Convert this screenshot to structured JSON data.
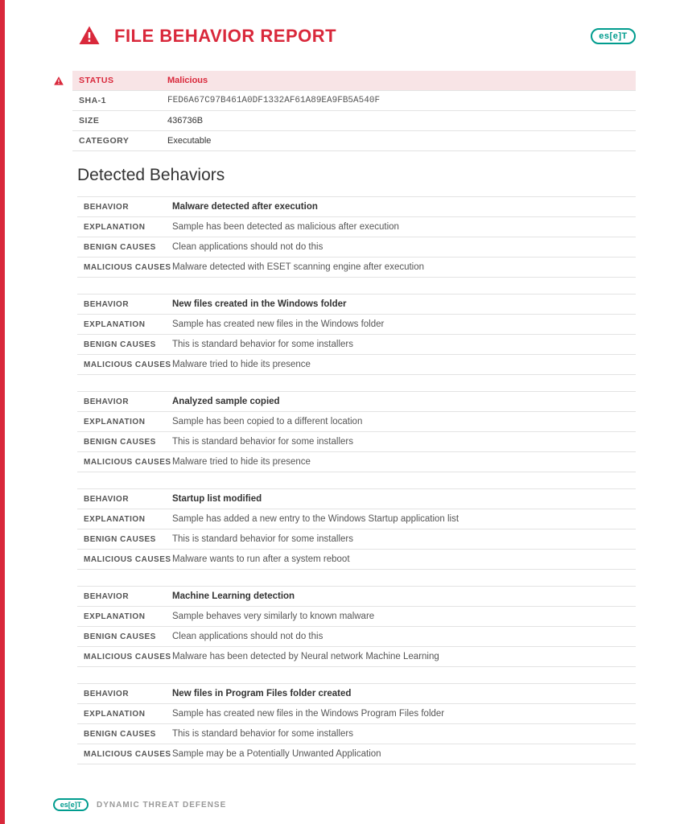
{
  "header": {
    "title": "FILE BEHAVIOR REPORT",
    "logo_text": "es[e]T"
  },
  "summary": {
    "status_label": "STATUS",
    "status_value": "Malicious",
    "sha1_label": "SHA-1",
    "sha1_value": "FED6A67C97B461A0DF1332AF61A89EA9FB5A540F",
    "size_label": "SIZE",
    "size_value": "436736B",
    "category_label": "CATEGORY",
    "category_value": "Executable"
  },
  "section_title": "Detected Behaviors",
  "row_labels": {
    "behavior": "BEHAVIOR",
    "explanation": "EXPLANATION",
    "benign": "BENIGN CAUSES",
    "malicious": "MALICIOUS CAUSES"
  },
  "behaviors": [
    {
      "behavior": "Malware detected after execution",
      "explanation": "Sample has been detected as malicious after execution",
      "benign": "Clean applications should not do this",
      "malicious": "Malware detected with ESET scanning engine after execution"
    },
    {
      "behavior": "New files created in the Windows folder",
      "explanation": "Sample has created new files in the Windows folder",
      "benign": "This is standard behavior for some installers",
      "malicious": "Malware tried to hide its presence"
    },
    {
      "behavior": "Analyzed sample copied",
      "explanation": "Sample has been copied to a different location",
      "benign": "This is standard behavior for some installers",
      "malicious": "Malware tried to hide its presence"
    },
    {
      "behavior": "Startup list modified",
      "explanation": "Sample has added a new entry to the Windows Startup application list",
      "benign": "This is standard behavior for some installers",
      "malicious": "Malware wants to run after a system reboot"
    },
    {
      "behavior": "Machine Learning detection",
      "explanation": "Sample behaves very similarly to known malware",
      "benign": "Clean applications should not do this",
      "malicious": "Malware has been detected by Neural network Machine Learning"
    },
    {
      "behavior": "New files in Program Files folder created",
      "explanation": "Sample has created new files in the Windows Program Files folder",
      "benign": "This is standard behavior for some installers",
      "malicious": "Sample may be a Potentially Unwanted Application"
    }
  ],
  "footer": {
    "logo_text": "es[e]T",
    "text": "DYNAMIC THREAT DEFENSE"
  }
}
